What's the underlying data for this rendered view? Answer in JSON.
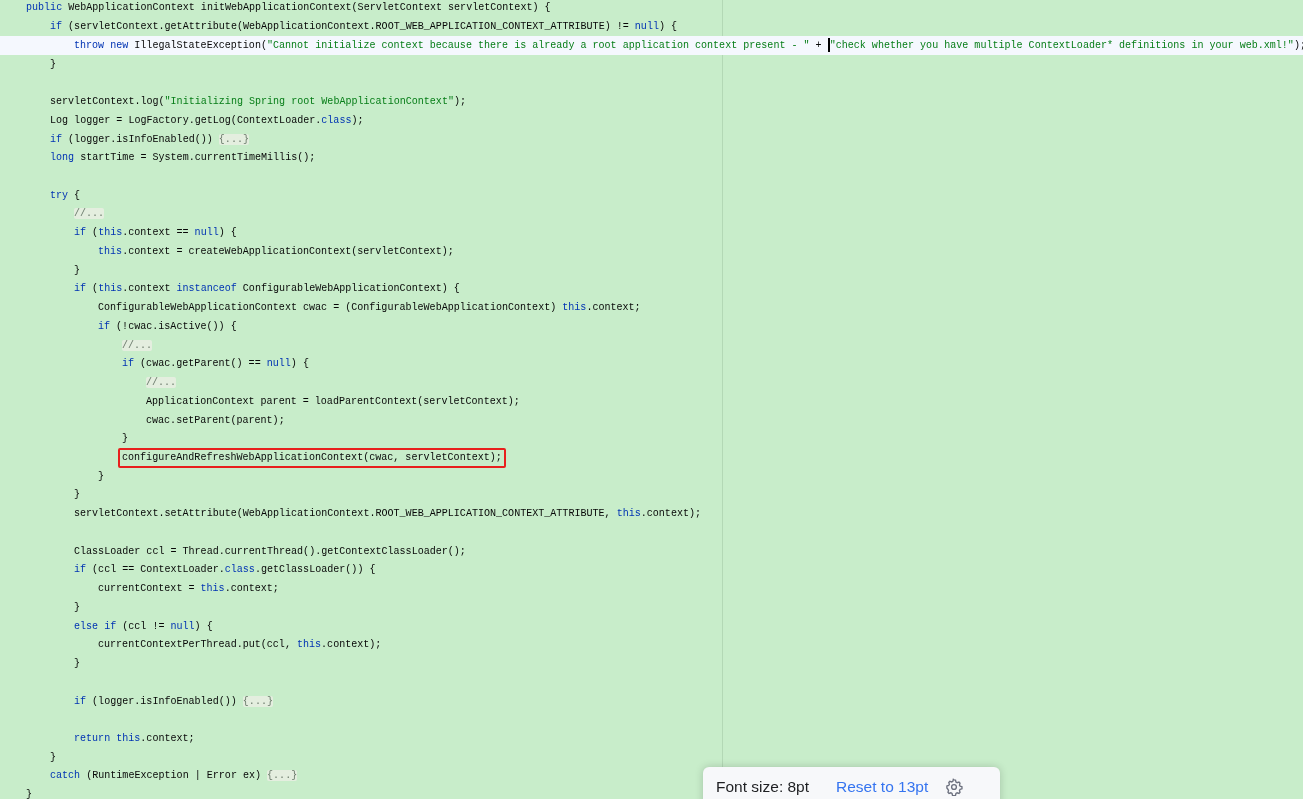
{
  "editor": {
    "lines": [
      {
        "kind": "code",
        "current": false,
        "boxed": false,
        "tokens": [
          {
            "kind": "kw",
            "text": "public"
          },
          {
            "kind": "plain",
            "text": " WebApplicationContext initWebApplicationContext(ServletContext servletContext) {"
          }
        ],
        "children": [
          {
            "kind": "code",
            "current": false,
            "boxed": false,
            "tokens": [
              {
                "kind": "kw",
                "text": "if"
              },
              {
                "kind": "plain",
                "text": " (servletContext.getAttribute(WebApplicationContext.ROOT_WEB_APPLICATION_CONTEXT_ATTRIBUTE) != "
              },
              {
                "kind": "kw",
                "text": "null"
              },
              {
                "kind": "plain",
                "text": ") {"
              }
            ],
            "children": [
              {
                "kind": "code",
                "current": true,
                "boxed": false,
                "tokens": [
                  {
                    "kind": "kw",
                    "text": "throw new"
                  },
                  {
                    "kind": "plain",
                    "text": " IllegalStateException("
                  },
                  {
                    "kind": "str",
                    "text": "\"Cannot initialize context because there is already a root application context present - \""
                  },
                  {
                    "kind": "plain",
                    "text": " + "
                  },
                  {
                    "kind": "caret"
                  },
                  {
                    "kind": "str",
                    "text": "\"check whether you have multiple ContextLoader* definitions in your web.xml!\""
                  },
                  {
                    "kind": "plain",
                    "text": ");"
                  }
                ]
              }
            ]
          },
          {
            "kind": "code",
            "current": false,
            "boxed": false,
            "tokens": [
              {
                "kind": "plain",
                "text": "}"
              }
            ]
          },
          {
            "kind": "blank"
          },
          {
            "kind": "code",
            "current": false,
            "boxed": false,
            "tokens": [
              {
                "kind": "plain",
                "text": "servletContext.log("
              },
              {
                "kind": "str",
                "text": "\"Initializing Spring root WebApplicationContext\""
              },
              {
                "kind": "plain",
                "text": ");"
              }
            ]
          },
          {
            "kind": "code",
            "current": false,
            "boxed": false,
            "tokens": [
              {
                "kind": "plain",
                "text": "Log logger = LogFactory.getLog(ContextLoader."
              },
              {
                "kind": "kw",
                "text": "class"
              },
              {
                "kind": "plain",
                "text": ");"
              }
            ]
          },
          {
            "kind": "code",
            "current": false,
            "boxed": false,
            "tokens": [
              {
                "kind": "kw",
                "text": "if"
              },
              {
                "kind": "plain",
                "text": " (logger.isInfoEnabled()) "
              },
              {
                "kind": "fold",
                "text": "{...}"
              }
            ]
          },
          {
            "kind": "code",
            "current": false,
            "boxed": false,
            "tokens": [
              {
                "kind": "kw",
                "text": "long"
              },
              {
                "kind": "plain",
                "text": " startTime = System.currentTimeMillis();"
              }
            ]
          },
          {
            "kind": "blank"
          },
          {
            "kind": "code",
            "current": false,
            "boxed": false,
            "tokens": [
              {
                "kind": "kw",
                "text": "try"
              },
              {
                "kind": "plain",
                "text": " {"
              }
            ],
            "children": [
              {
                "kind": "code",
                "current": false,
                "boxed": false,
                "tokens": [
                  {
                    "kind": "fold",
                    "text": "//..."
                  }
                ]
              },
              {
                "kind": "code",
                "current": false,
                "boxed": false,
                "tokens": [
                  {
                    "kind": "kw",
                    "text": "if"
                  },
                  {
                    "kind": "plain",
                    "text": " ("
                  },
                  {
                    "kind": "kw",
                    "text": "this"
                  },
                  {
                    "kind": "plain",
                    "text": ".context == "
                  },
                  {
                    "kind": "kw",
                    "text": "null"
                  },
                  {
                    "kind": "plain",
                    "text": ") {"
                  }
                ],
                "children": [
                  {
                    "kind": "code",
                    "current": false,
                    "boxed": false,
                    "tokens": [
                      {
                        "kind": "kw",
                        "text": "this"
                      },
                      {
                        "kind": "plain",
                        "text": ".context = createWebApplicationContext(servletContext);"
                      }
                    ]
                  }
                ]
              },
              {
                "kind": "code",
                "current": false,
                "boxed": false,
                "tokens": [
                  {
                    "kind": "plain",
                    "text": "}"
                  }
                ]
              },
              {
                "kind": "code",
                "current": false,
                "boxed": false,
                "tokens": [
                  {
                    "kind": "kw",
                    "text": "if"
                  },
                  {
                    "kind": "plain",
                    "text": " ("
                  },
                  {
                    "kind": "kw",
                    "text": "this"
                  },
                  {
                    "kind": "plain",
                    "text": ".context "
                  },
                  {
                    "kind": "kw",
                    "text": "instanceof"
                  },
                  {
                    "kind": "plain",
                    "text": " ConfigurableWebApplicationContext) {"
                  }
                ],
                "children": [
                  {
                    "kind": "code",
                    "current": false,
                    "boxed": false,
                    "tokens": [
                      {
                        "kind": "plain",
                        "text": "ConfigurableWebApplicationContext cwac = (ConfigurableWebApplicationContext) "
                      },
                      {
                        "kind": "kw",
                        "text": "this"
                      },
                      {
                        "kind": "plain",
                        "text": ".context;"
                      }
                    ]
                  },
                  {
                    "kind": "code",
                    "current": false,
                    "boxed": false,
                    "tokens": [
                      {
                        "kind": "kw",
                        "text": "if"
                      },
                      {
                        "kind": "plain",
                        "text": " (!cwac.isActive()) {"
                      }
                    ],
                    "children": [
                      {
                        "kind": "code",
                        "current": false,
                        "boxed": false,
                        "tokens": [
                          {
                            "kind": "fold",
                            "text": "//..."
                          }
                        ]
                      },
                      {
                        "kind": "code",
                        "current": false,
                        "boxed": false,
                        "tokens": [
                          {
                            "kind": "kw",
                            "text": "if"
                          },
                          {
                            "kind": "plain",
                            "text": " (cwac.getParent() == "
                          },
                          {
                            "kind": "kw",
                            "text": "null"
                          },
                          {
                            "kind": "plain",
                            "text": ") {"
                          }
                        ],
                        "children": [
                          {
                            "kind": "code",
                            "current": false,
                            "boxed": false,
                            "tokens": [
                              {
                                "kind": "fold",
                                "text": "//..."
                              }
                            ]
                          },
                          {
                            "kind": "code",
                            "current": false,
                            "boxed": false,
                            "tokens": [
                              {
                                "kind": "plain",
                                "text": "ApplicationContext parent = loadParentContext(servletContext);"
                              }
                            ]
                          },
                          {
                            "kind": "code",
                            "current": false,
                            "boxed": false,
                            "tokens": [
                              {
                                "kind": "plain",
                                "text": "cwac.setParent(parent);"
                              }
                            ]
                          }
                        ]
                      },
                      {
                        "kind": "code",
                        "current": false,
                        "boxed": false,
                        "tokens": [
                          {
                            "kind": "plain",
                            "text": "}"
                          }
                        ]
                      },
                      {
                        "kind": "code",
                        "current": false,
                        "boxed": true,
                        "tokens": [
                          {
                            "kind": "plain",
                            "text": "configureAndRefreshWebApplicationContext(cwac, servletContext);"
                          }
                        ]
                      }
                    ]
                  },
                  {
                    "kind": "code",
                    "current": false,
                    "boxed": false,
                    "tokens": [
                      {
                        "kind": "plain",
                        "text": "}"
                      }
                    ]
                  }
                ]
              },
              {
                "kind": "code",
                "current": false,
                "boxed": false,
                "tokens": [
                  {
                    "kind": "plain",
                    "text": "}"
                  }
                ]
              },
              {
                "kind": "code",
                "current": false,
                "boxed": false,
                "tokens": [
                  {
                    "kind": "plain",
                    "text": "servletContext.setAttribute(WebApplicationContext.ROOT_WEB_APPLICATION_CONTEXT_ATTRIBUTE, "
                  },
                  {
                    "kind": "kw",
                    "text": "this"
                  },
                  {
                    "kind": "plain",
                    "text": ".context);"
                  }
                ]
              },
              {
                "kind": "blank"
              },
              {
                "kind": "code",
                "current": false,
                "boxed": false,
                "tokens": [
                  {
                    "kind": "plain",
                    "text": "ClassLoader ccl = Thread.currentThread().getContextClassLoader();"
                  }
                ]
              },
              {
                "kind": "code",
                "current": false,
                "boxed": false,
                "tokens": [
                  {
                    "kind": "kw",
                    "text": "if"
                  },
                  {
                    "kind": "plain",
                    "text": " (ccl == ContextLoader."
                  },
                  {
                    "kind": "kw",
                    "text": "class"
                  },
                  {
                    "kind": "plain",
                    "text": ".getClassLoader()) {"
                  }
                ],
                "children": [
                  {
                    "kind": "code",
                    "current": false,
                    "boxed": false,
                    "tokens": [
                      {
                        "kind": "plain",
                        "text": "currentContext = "
                      },
                      {
                        "kind": "kw",
                        "text": "this"
                      },
                      {
                        "kind": "plain",
                        "text": ".context;"
                      }
                    ]
                  }
                ]
              },
              {
                "kind": "code",
                "current": false,
                "boxed": false,
                "tokens": [
                  {
                    "kind": "plain",
                    "text": "}"
                  }
                ]
              },
              {
                "kind": "code",
                "current": false,
                "boxed": false,
                "tokens": [
                  {
                    "kind": "kw",
                    "text": "else if"
                  },
                  {
                    "kind": "plain",
                    "text": " (ccl != "
                  },
                  {
                    "kind": "kw",
                    "text": "null"
                  },
                  {
                    "kind": "plain",
                    "text": ") {"
                  }
                ],
                "children": [
                  {
                    "kind": "code",
                    "current": false,
                    "boxed": false,
                    "tokens": [
                      {
                        "kind": "plain",
                        "text": "currentContextPerThread.put(ccl, "
                      },
                      {
                        "kind": "kw",
                        "text": "this"
                      },
                      {
                        "kind": "plain",
                        "text": ".context);"
                      }
                    ]
                  }
                ]
              },
              {
                "kind": "code",
                "current": false,
                "boxed": false,
                "tokens": [
                  {
                    "kind": "plain",
                    "text": "}"
                  }
                ]
              },
              {
                "kind": "blank"
              },
              {
                "kind": "code",
                "current": false,
                "boxed": false,
                "tokens": [
                  {
                    "kind": "kw",
                    "text": "if"
                  },
                  {
                    "kind": "plain",
                    "text": " (logger.isInfoEnabled()) "
                  },
                  {
                    "kind": "fold",
                    "text": "{...}"
                  }
                ]
              },
              {
                "kind": "blank"
              },
              {
                "kind": "code",
                "current": false,
                "boxed": false,
                "tokens": [
                  {
                    "kind": "kw",
                    "text": "return this"
                  },
                  {
                    "kind": "plain",
                    "text": ".context;"
                  }
                ]
              }
            ]
          },
          {
            "kind": "code",
            "current": false,
            "boxed": false,
            "tokens": [
              {
                "kind": "plain",
                "text": "}"
              }
            ]
          },
          {
            "kind": "code",
            "current": false,
            "boxed": false,
            "tokens": [
              {
                "kind": "kw",
                "text": "catch"
              },
              {
                "kind": "plain",
                "text": " (RuntimeException | Error ex) "
              },
              {
                "kind": "fold",
                "text": "{...}"
              }
            ]
          }
        ]
      },
      {
        "kind": "code",
        "current": false,
        "boxed": false,
        "tokens": [
          {
            "kind": "plain",
            "text": "}"
          }
        ]
      }
    ]
  },
  "font_popup": {
    "label": "Font size: 8pt",
    "reset_link": "Reset to 13pt"
  }
}
